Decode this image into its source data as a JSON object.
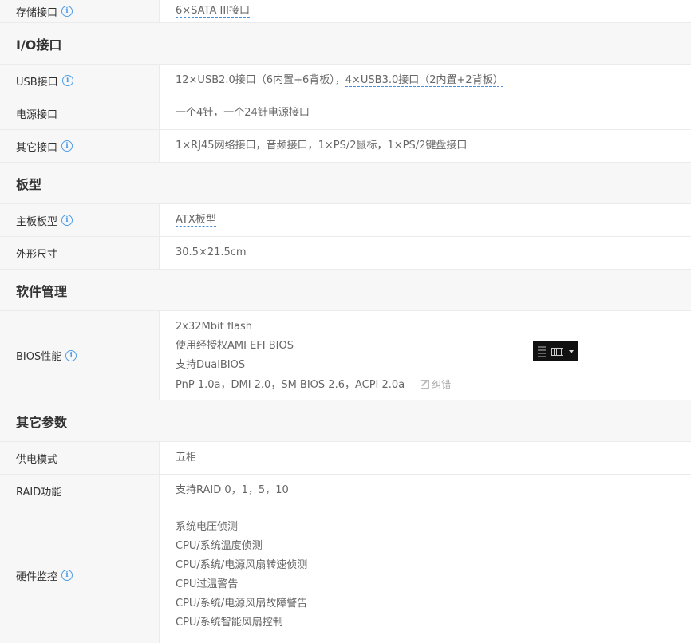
{
  "rows": {
    "storage": {
      "label": "存储接口",
      "value": "6×SATA III接口"
    },
    "io_header": "I/O接口",
    "usb": {
      "label": "USB接口",
      "part1": "12×USB2.0接口（6内置+6背板）",
      "sep": "，",
      "part2": "4×USB3.0接口（2内置+2背板）"
    },
    "power": {
      "label": "电源接口",
      "value": "一个4针，一个24针电源接口"
    },
    "other_port": {
      "label": "其它接口",
      "value": "1×RJ45网络接口，音频接口，1×PS/2鼠标，1×PS/2键盘接口"
    },
    "board_header": "板型",
    "form_factor": {
      "label": "主板板型",
      "value": "ATX板型"
    },
    "dimensions": {
      "label": "外形尺寸",
      "value": "30.5×21.5cm"
    },
    "software_header": "软件管理",
    "bios": {
      "label": "BIOS性能",
      "lines": [
        "2x32Mbit flash",
        "使用经授权AMI EFI BIOS",
        "支持DualBIOS",
        "PnP 1.0a，DMI 2.0，SM BIOS 2.6，ACPI 2.0a"
      ],
      "correction": "纠错"
    },
    "other_header": "其它参数",
    "power_mode": {
      "label": "供电模式",
      "value": "五相"
    },
    "raid": {
      "label": "RAID功能",
      "value": "支持RAID 0，1，5，10"
    },
    "hw_monitor": {
      "label": "硬件监控",
      "lines": [
        "系统电压侦测",
        "CPU/系统温度侦测",
        "CPU/系统/电源风扇转速侦测",
        "CPU过温警告",
        "CPU/系统/电源风扇故障警告",
        "CPU/系统智能风扇控制"
      ]
    }
  },
  "info_glyph": "i",
  "icons": {
    "info": "info-circle-icon",
    "edit": "edit-icon",
    "keyboard": "keyboard-icon"
  },
  "colors": {
    "info_blue": "#4f9ee8",
    "label_bg": "#f7f7f7",
    "border": "#ebebeb"
  }
}
